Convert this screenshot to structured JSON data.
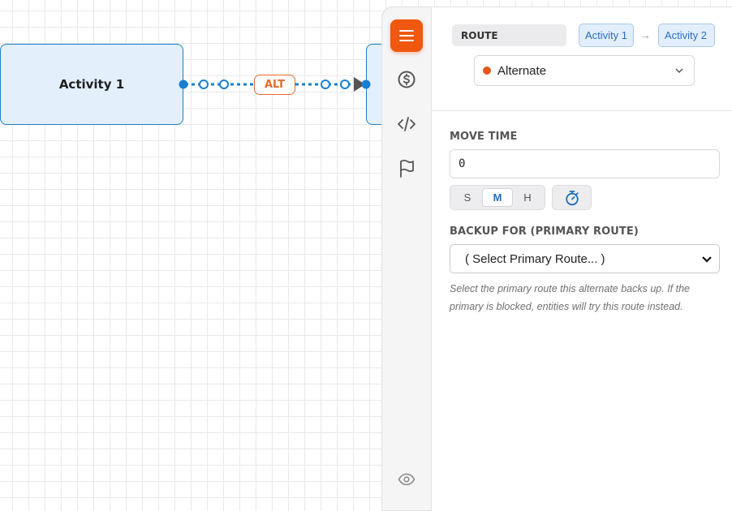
{
  "canvas": {
    "nodes": [
      {
        "label": "Activity 1"
      },
      {
        "label": ""
      }
    ],
    "edge": {
      "badge": "ALT"
    }
  },
  "rail": {
    "buttons": [
      {
        "icon": "menu-icon",
        "active": true
      },
      {
        "icon": "dollar-circle-icon",
        "active": false
      },
      {
        "icon": "code-icon",
        "active": false
      },
      {
        "icon": "flag-icon",
        "active": false
      },
      {
        "icon": "eye-icon",
        "active": false
      }
    ]
  },
  "panel": {
    "header": {
      "type_label": "ROUTE",
      "from": "Activity 1",
      "arrow": "→",
      "to": "Activity 2",
      "kind": "Alternate",
      "kind_color": "#e2561a"
    },
    "move_time": {
      "label": "MOVE TIME",
      "value": "0",
      "units": [
        "S",
        "M",
        "H"
      ],
      "selected_unit": "M"
    },
    "backup": {
      "label": "BACKUP FOR (PRIMARY ROUTE)",
      "selected": "( Select Primary Route... )",
      "help": "Select the primary route this alternate backs up. If the primary is blocked, entities will try this route instead."
    }
  },
  "colors": {
    "accent": "#f0570f",
    "node_border": "#1c7fc7",
    "edge": "#1a7fd0",
    "alt_badge": "#e46b2a",
    "unit_selected": "#1f6fb8"
  }
}
